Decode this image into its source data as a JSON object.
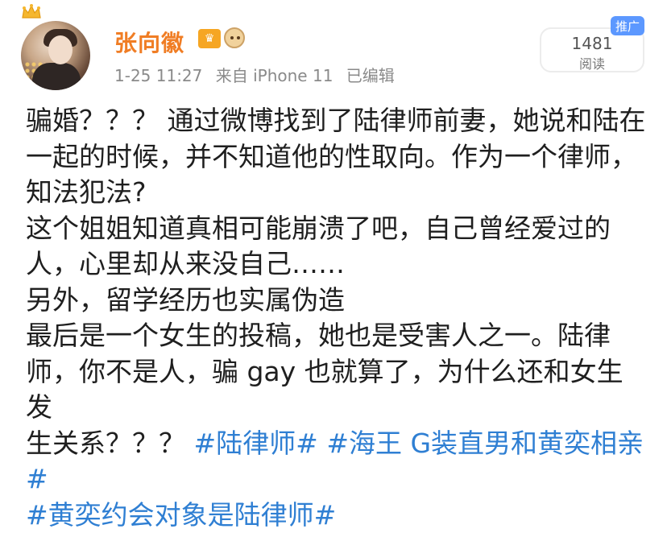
{
  "post": {
    "author": "张向徽",
    "timestamp": "1-25 11:27",
    "source": "来自 iPhone 11",
    "edited": "已编辑",
    "reads_count": "1481",
    "reads_label": "阅读",
    "promo": "推广"
  },
  "icons": {
    "crown": "crown-icon",
    "vip": "vip-badge-icon",
    "monkey": "monkey-badge-icon"
  },
  "content": {
    "line1": "骗婚？？？ 通过微博找到了陆律师前妻，她说和陆在",
    "line2": "一起的时候，并不知道他的性取向。作为一个律师，",
    "line3": "知法犯法?",
    "line4": "这个姐姐知道真相可能崩溃了吧，自己曾经爱过的",
    "line5": "人，心里却从来没自己……",
    "line6": "另外，留学经历也实属伪造",
    "line7": "最后是一个女生的投稿，她也是受害人之一。陆律",
    "line8": "师，你不是人，骗 gay 也就算了，为什么还和女生发",
    "line9_text": "生关系？？？ ",
    "hashtag1": "#陆律师#",
    "hashtag2": "#海王 G装直男和黄奕相亲#",
    "hashtag3": "#黄奕约会对象是陆律师#"
  },
  "colors": {
    "username": "#f07d24",
    "hashtag": "#2f7fd3",
    "promo": "#5c98ff"
  }
}
